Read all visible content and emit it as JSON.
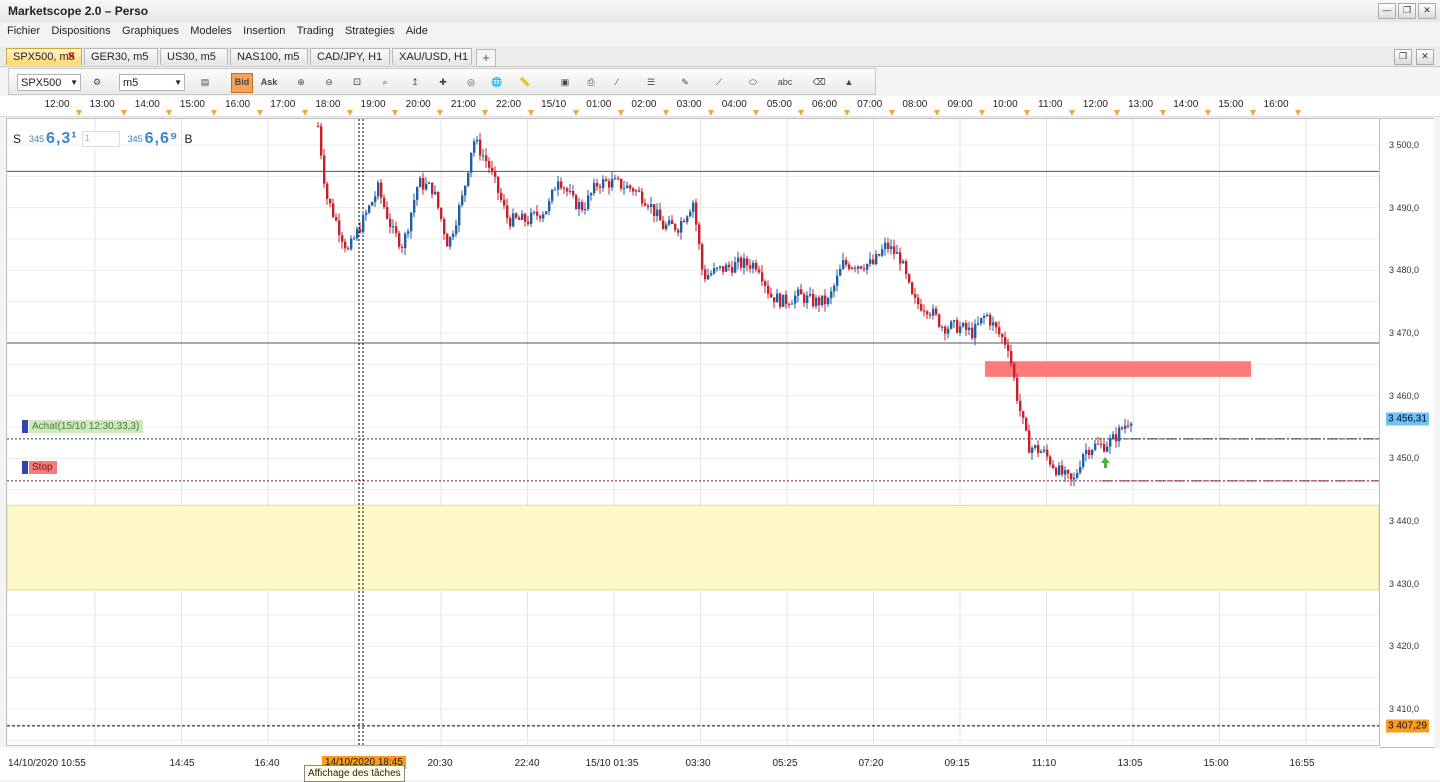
{
  "window": {
    "title": "Marketscope 2.0 – Perso"
  },
  "menu": [
    "Fichier",
    "Dispositions",
    "Graphiques",
    "Modeles",
    "Insertion",
    "Trading",
    "Strategies",
    "Aide"
  ],
  "tabs": [
    {
      "label": "SPX500, m5",
      "active": true
    },
    {
      "label": "GER30, m5",
      "active": false
    },
    {
      "label": "US30, m5",
      "active": false
    },
    {
      "label": "NAS100, m5",
      "active": false
    },
    {
      "label": "CAD/JPY, H1",
      "active": false
    },
    {
      "label": "XAU/USD, H1",
      "active": false
    }
  ],
  "toolbar": {
    "instrument": "SPX500",
    "timeframe": "m5",
    "bid_label": "Bid",
    "ask_label": "Ask",
    "icons": [
      "chart-type-icon",
      "lines-icon",
      "zoom-in-icon",
      "zoom-out-icon",
      "zoom-fit-icon",
      "scroll-icon",
      "crosshair-icon",
      "screenshot-icon",
      "globe-icon",
      "ruler-icon",
      "picture-icon",
      "print-icon",
      "fib-icon",
      "lines-style-icon",
      "pen-icon",
      "line-tool-icon",
      "shape-icon",
      "text-icon",
      "eraser-icon",
      "tree-icon"
    ]
  },
  "time_axis_top": [
    "12:00",
    "13:00",
    "14:00",
    "15:00",
    "16:00",
    "17:00",
    "18:00",
    "19:00",
    "20:00",
    "21:00",
    "22:00",
    "15/10",
    "01:00",
    "02:00",
    "03:00",
    "04:00",
    "05:00",
    "06:00",
    "07:00",
    "08:00",
    "09:00",
    "10:00",
    "11:00",
    "12:00",
    "13:00",
    "14:00",
    "15:00",
    "16:00"
  ],
  "time_axis_bottom": [
    "14/10/2020 10:55",
    "14:45",
    "16:40",
    "20:30",
    "22:40",
    "15/10 01:35",
    "03:30",
    "05:25",
    "07:20",
    "09:15",
    "11:10",
    "13:05",
    "15:00",
    "16:55"
  ],
  "crosshair_time": "14/10/2020 18:45",
  "tooltip": "Affichage des tâches",
  "price_axis": [
    "3 500,0",
    "3 490,0",
    "3 480,0",
    "3 470,0",
    "3 460,0",
    "3 450,0",
    "3 440,0",
    "3 430,0",
    "3 420,0",
    "3 410,0"
  ],
  "current_price": "3 456,31",
  "low_price": "3 407,29",
  "dealer": {
    "sell_label": "S",
    "sell_small": "345",
    "sell_big": "6,3¹",
    "amount": "1",
    "buy_small": "345",
    "buy_big": "6,6⁹",
    "buy_label": "B"
  },
  "orders": [
    {
      "label": "Achat(15/10 12:30,33,3)"
    },
    {
      "label": "Stop"
    }
  ],
  "colors": {
    "bull": "#1f5ea8",
    "bear": "#c8202a",
    "zone_yellow": "#fff9c9",
    "zone_red": "#ff7b7b",
    "accent_orange": "#f89b1e",
    "price_blue": "#6fc3f1"
  }
}
